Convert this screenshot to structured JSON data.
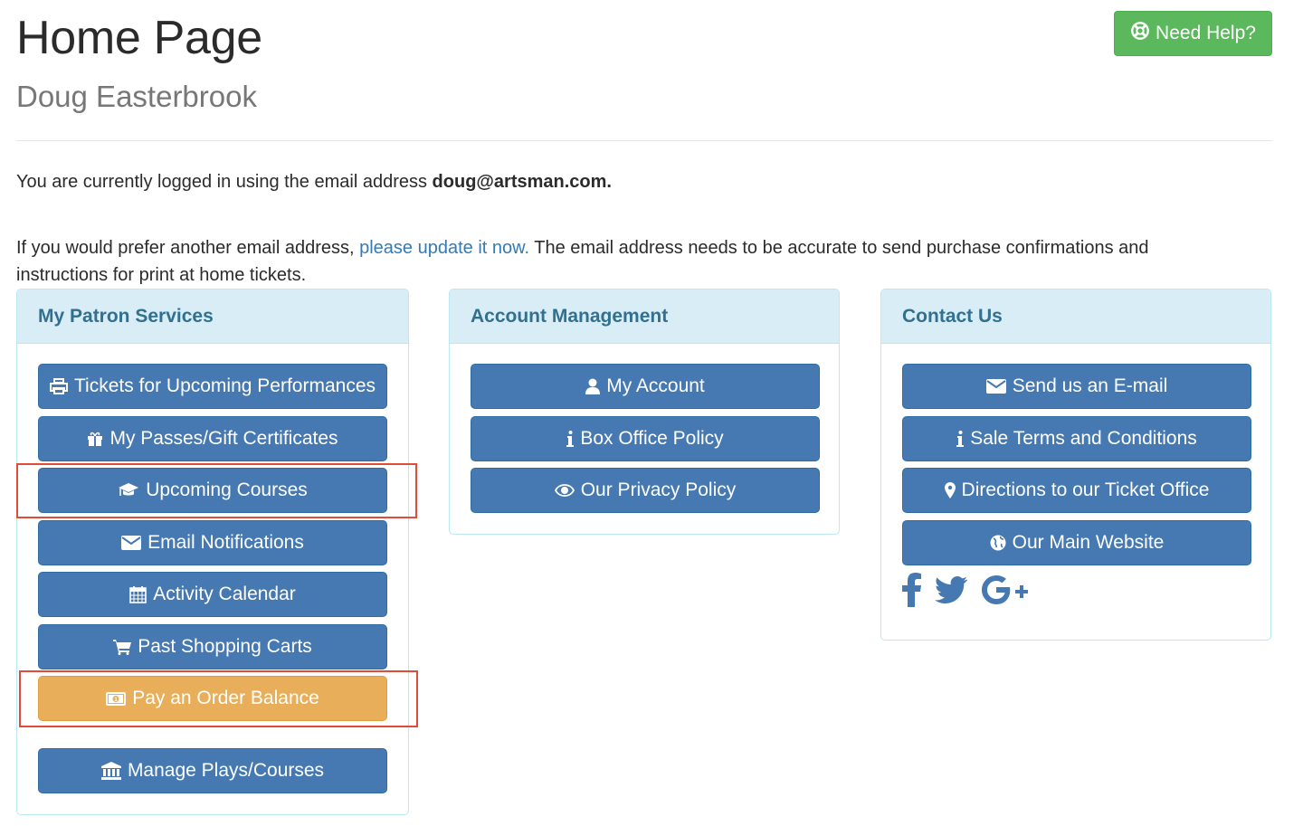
{
  "header": {
    "title": "Home Page",
    "subtitle": "Doug Easterbrook",
    "help_button": "Need Help?"
  },
  "intro": {
    "logged_in_prefix": "You are currently logged in using the email address",
    "email": "doug@artsman.com.",
    "update_prefix": "If you would prefer another email address,",
    "update_link": "please update it now.",
    "update_suffix": "The email address needs to be accurate to send purchase confirmations and instructions for print at home tickets."
  },
  "panels": {
    "patron": {
      "title": "My Patron Services",
      "buttons": [
        {
          "label": "Tickets for Upcoming Performances",
          "icon": "print-icon"
        },
        {
          "label": "My Passes/Gift Certificates",
          "icon": "gift-icon"
        },
        {
          "label": "Upcoming Courses",
          "icon": "graduation-cap-icon"
        },
        {
          "label": "Email Notifications",
          "icon": "envelope-icon"
        },
        {
          "label": "Activity Calendar",
          "icon": "calendar-icon"
        },
        {
          "label": "Past Shopping Carts",
          "icon": "shopping-cart-icon"
        },
        {
          "label": "Pay an Order Balance",
          "icon": "money-icon"
        },
        {
          "label": "Manage Plays/Courses",
          "icon": "bank-icon"
        }
      ]
    },
    "account": {
      "title": "Account Management",
      "buttons": [
        {
          "label": "My Account",
          "icon": "user-icon"
        },
        {
          "label": "Box Office Policy",
          "icon": "info-icon"
        },
        {
          "label": "Our Privacy Policy",
          "icon": "eye-icon"
        }
      ]
    },
    "contact": {
      "title": "Contact Us",
      "buttons": [
        {
          "label": "Send us an E-mail",
          "icon": "envelope-icon"
        },
        {
          "label": "Sale Terms and Conditions",
          "icon": "info-icon"
        },
        {
          "label": "Directions to our Ticket Office",
          "icon": "map-marker-icon"
        },
        {
          "label": "Our Main Website",
          "icon": "globe-icon"
        }
      ],
      "social": [
        "facebook-icon",
        "twitter-icon",
        "google-plus-icon"
      ]
    }
  },
  "colors": {
    "primary": "#4679b2",
    "success": "#5cb85c",
    "warning": "#e8ae5a",
    "panel_heading": "#d9edf7",
    "panel_title": "#31708f",
    "link": "#337ab7",
    "highlight": "#e04b3a"
  }
}
